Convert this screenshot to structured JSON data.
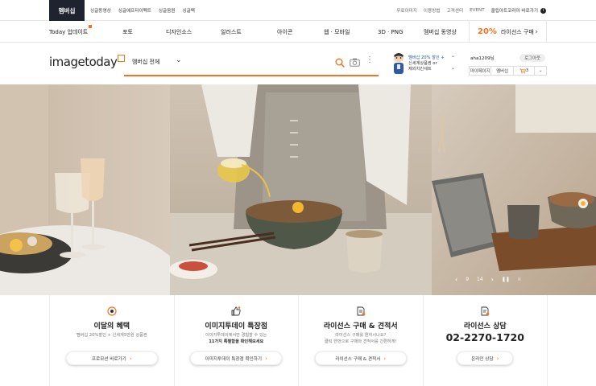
{
  "topbar": {
    "member_label": "멤버십",
    "links": [
      "싱글동영상",
      "싱글에프터이펙트",
      "싱글음원",
      "싱글팩"
    ],
    "right_links": [
      "무료이미지",
      "이용방법",
      "고객센터",
      "EVENT"
    ],
    "ccl_label": "클립아트코리아 바로가기"
  },
  "nav": {
    "items": [
      "Today 업데이트",
      "포토",
      "디자인소스",
      "일러스트",
      "아이콘",
      "웹 · 모바일",
      "3D · PNG",
      "멤버십 동영상"
    ],
    "promo_pct": "20%",
    "promo_label": "라이선스 구매"
  },
  "header": {
    "logo_text": "imagetoday",
    "search_scope": "멤버십 전체",
    "search_placeholder": "",
    "banner_line1": "멤버십 20% 할인 +",
    "banner_line2": "신세계상품권 or",
    "banner_line3": "제외치킨세트"
  },
  "user": {
    "username": "aha1209님",
    "logout": "로그아웃",
    "mypage": "마이페이지",
    "membership": "멤버십",
    "cart_count": "3"
  },
  "hero": {
    "current_slide": "9",
    "total_slides": "14",
    "bowl_text": "흙로만찬"
  },
  "benefits": [
    {
      "title": "이달의 혜택",
      "desc1": "멤버십 20%할인 + 신세계5만원 상품권",
      "desc2": "",
      "button": "프로모션 바로가기"
    },
    {
      "title": "이미지투데이 특장점",
      "desc1": "이미지투데이에서만 경험할 수 있는",
      "desc2": "11가지 특별함을 확인해보세요",
      "button": "이미지투데이 특장점 확인하기"
    },
    {
      "title": "라이선스 구매 & 견적서",
      "desc1": "라이선스 구매를 원하시나요?",
      "desc2": "클릭 한번으로 구매와 견적서를 간편하게!",
      "button": "라이선스 구매 & 견적서"
    },
    {
      "title": "라이선스 상담",
      "phone": "02-2270-1720",
      "button": "온라인 상담"
    }
  ],
  "colors": {
    "accent": "#f37321",
    "dark": "#1f2330"
  },
  "icons": [
    "search-icon",
    "camera-icon",
    "more-icon",
    "chevron-down-icon",
    "coin-icon",
    "thumbs-up-icon",
    "document-icon",
    "chevron-right-icon",
    "pause-icon",
    "grid-icon"
  ]
}
